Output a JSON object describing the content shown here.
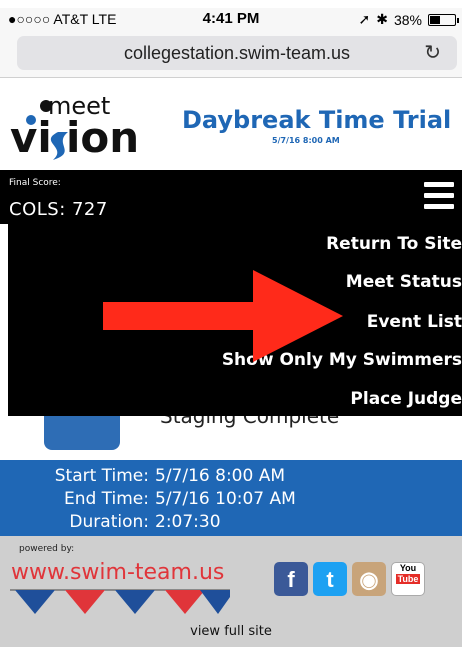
{
  "status_bar": {
    "carrier": "●○○○○ AT&T  LTE",
    "time": "4:41 PM",
    "battery": "38%"
  },
  "browser": {
    "url": "collegestation.swim-team.us",
    "reload_icon": "reload-icon"
  },
  "header": {
    "title": "Daybreak Time Trial",
    "subtitle": "5/7/16 8:00 AM",
    "logo_text": "meet vision"
  },
  "score": {
    "label": "Final Score:",
    "value": "COLS: 727"
  },
  "menu": {
    "items": [
      "Return To Site",
      "Meet Status",
      "Event List",
      "Show Only My Swimmers",
      "Place Judge"
    ]
  },
  "background": {
    "staging_text": "Staging Complete"
  },
  "times": {
    "start_label": "Start Time:",
    "start_value": "5/7/16 8:00 AM",
    "end_label": "End Time:",
    "end_value": "5/7/16 10:07 AM",
    "duration_label": "Duration:",
    "duration_value": "2:07:30"
  },
  "footer": {
    "powered_by": "powered by:",
    "brand": "www.swim-team.us",
    "social": [
      "facebook-icon",
      "twitter-icon",
      "instagram-icon",
      "youtube-icon"
    ],
    "view_full_site": "view full site"
  },
  "colors": {
    "brand_blue": "#1f67b5",
    "arrow_red": "#ff2a1a",
    "menu_bg": "#000000"
  }
}
